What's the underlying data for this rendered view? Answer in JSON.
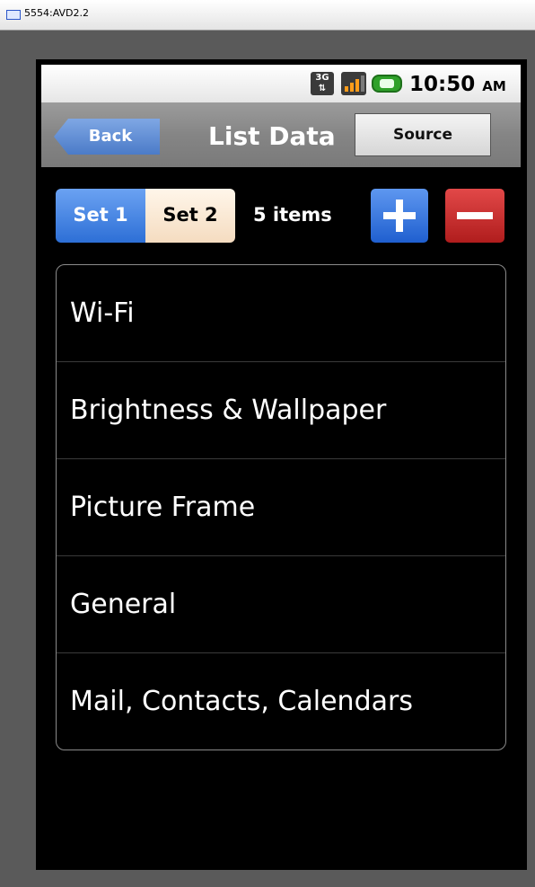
{
  "window": {
    "title": "5554:AVD2.2"
  },
  "status_bar": {
    "network_label": "3G",
    "time": "10:50",
    "ampm": "AM"
  },
  "nav": {
    "back_label": "Back",
    "title": "List Data",
    "source_label": "Source"
  },
  "toolbar": {
    "segments": [
      {
        "label": "Set 1",
        "selected": true
      },
      {
        "label": "Set 2",
        "selected": false
      }
    ],
    "count_label": "5 items"
  },
  "list": {
    "items": [
      {
        "label": "Wi-Fi"
      },
      {
        "label": "Brightness & Wallpaper"
      },
      {
        "label": "Picture Frame"
      },
      {
        "label": "General"
      },
      {
        "label": "Mail, Contacts, Calendars"
      }
    ]
  },
  "colors": {
    "selected_segment": "#2d6fd6",
    "add_button": "#1f5fcf",
    "remove_button": "#b01d1d",
    "screen_background": "#000000"
  },
  "icons": [
    "window-icon",
    "network-3g-icon",
    "signal-icon",
    "battery-icon",
    "plus-icon",
    "minus-icon"
  ]
}
